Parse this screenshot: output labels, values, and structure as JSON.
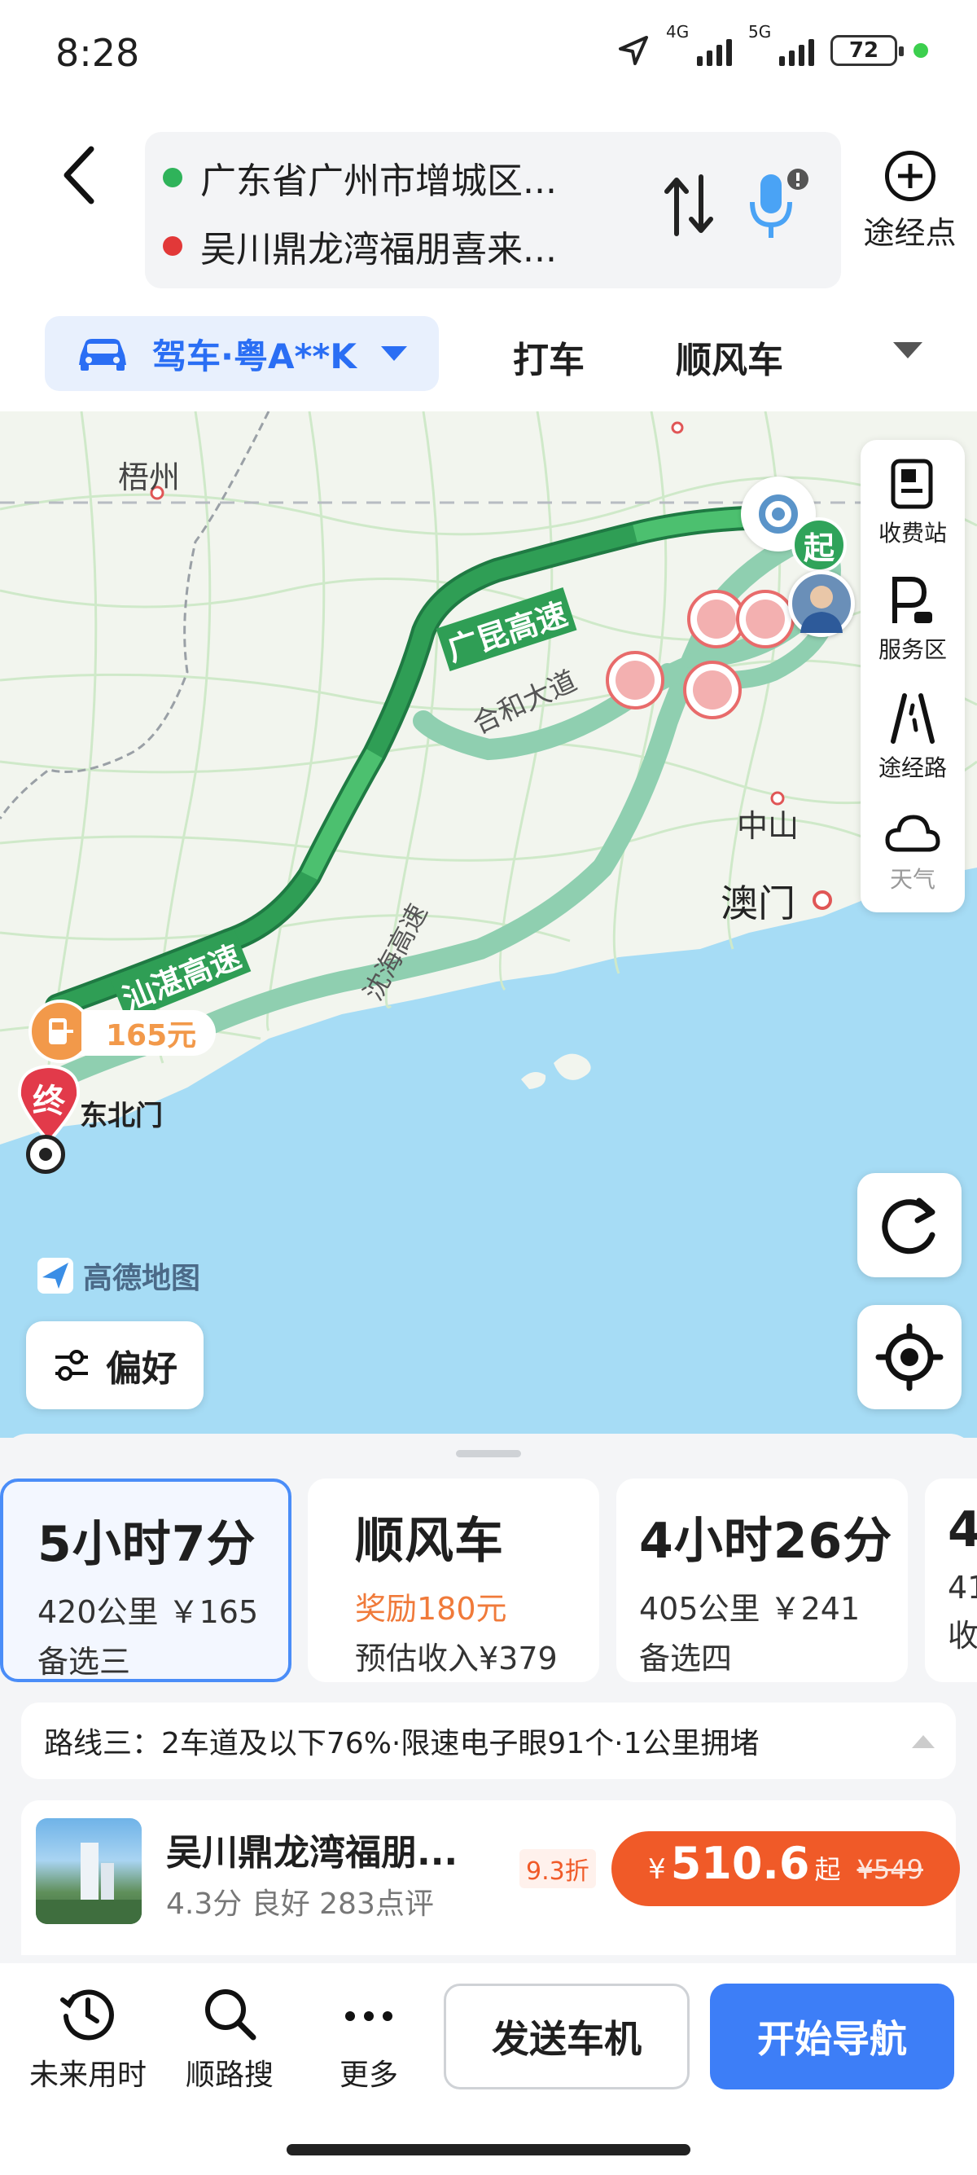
{
  "status_bar": {
    "time": "8:28",
    "net1": "4G",
    "net2": "5G",
    "battery": "72"
  },
  "header": {
    "origin": "广东省广州市增城区...",
    "destination": "吴川鼎龙湾福朋喜来...",
    "waypoint_label": "途经点"
  },
  "mode_tabs": {
    "drive": "驾车·粤A**K",
    "taxi": "打车",
    "carpool": "顺风车"
  },
  "map": {
    "place_labels": [
      "梧州",
      "中山",
      "澳门",
      "东北门"
    ],
    "road_labels": [
      "广昆高速",
      "合和大道",
      "沈海高速",
      "汕湛高速"
    ],
    "start_marker": "起",
    "end_marker": "终",
    "toll_tag": "165元",
    "watermark": "高德地图",
    "side_tools": [
      "收费站",
      "服务区",
      "途经路",
      "天气"
    ],
    "pref_button": "偏好"
  },
  "routes": [
    {
      "time": "5小时7分",
      "detail": "420公里 ￥165",
      "name": "备选三"
    },
    {
      "time": "顺风车",
      "reward": "奖励180元",
      "income": "预估收入¥379"
    },
    {
      "time": "4小时26分",
      "detail": "405公里 ￥241",
      "name": "备选四"
    },
    {
      "time": "4",
      "detail": "41",
      "name": "收"
    }
  ],
  "route_info": "路线三：2车道及以下76%·限速电子眼91个·1公里拥堵",
  "hotel": {
    "name": "吴川鼎龙湾福朋...",
    "rating": "4.3分 良好 283点评",
    "discount": "9.3折",
    "currency": "¥",
    "price": "510.6",
    "price_suffix": "起",
    "orig_price": "¥549"
  },
  "bottom_nav": {
    "future": "未来用时",
    "along": "顺路搜",
    "more": "更多",
    "send": "发送车机",
    "start": "开始导航"
  },
  "colors": {
    "accent": "#3d7ef7",
    "route_main": "#2f9e55",
    "route_alt": "#8fcfb0",
    "sea": "#a6dcf5",
    "price": "#f05a28"
  }
}
